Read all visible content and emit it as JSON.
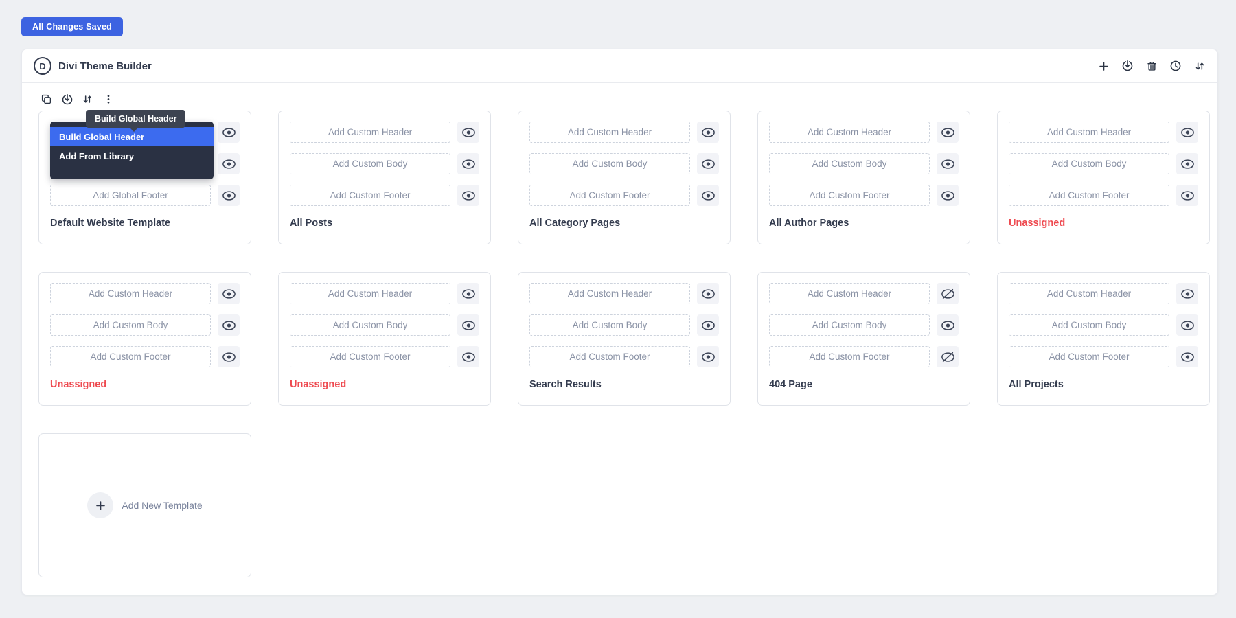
{
  "saved_badge": {
    "label": "All Changes Saved",
    "color": "#3d63e1"
  },
  "header": {
    "logo_letter": "D",
    "title": "Divi Theme Builder",
    "actions": [
      {
        "name": "new-template",
        "icon": "plus-icon"
      },
      {
        "name": "portability",
        "icon": "portability-icon"
      },
      {
        "name": "delete",
        "icon": "trash-icon"
      },
      {
        "name": "history",
        "icon": "history-icon"
      },
      {
        "name": "sort",
        "icon": "sort-icon"
      }
    ]
  },
  "card_toolbar": {
    "icons": [
      {
        "name": "duplicate",
        "icon": "duplicate-icon"
      },
      {
        "name": "portability",
        "icon": "portability-icon"
      },
      {
        "name": "sort",
        "icon": "sort-icon"
      },
      {
        "name": "more-options",
        "icon": "kebab-icon"
      }
    ]
  },
  "tooltip": {
    "label": "Build Global Header"
  },
  "dropdown": {
    "items": [
      {
        "label": "Build Global Header",
        "active": true
      },
      {
        "label": "Add From Library",
        "active": false
      }
    ]
  },
  "templates": [
    {
      "name": "Default Website Template",
      "unassigned": false,
      "overlay_open": true,
      "rows": [
        {
          "slot": "header",
          "covered": true,
          "eye": "visible"
        },
        {
          "slot": "body",
          "covered": true,
          "eye": "visible"
        },
        {
          "slot": "footer",
          "label": "Add Global Footer",
          "eye": "visible"
        }
      ]
    },
    {
      "name": "All Posts",
      "unassigned": false,
      "rows": [
        {
          "slot": "header",
          "label": "Add Custom Header",
          "eye": "visible"
        },
        {
          "slot": "body",
          "label": "Add Custom Body",
          "eye": "visible"
        },
        {
          "slot": "footer",
          "label": "Add Custom Footer",
          "eye": "visible"
        }
      ]
    },
    {
      "name": "All Category Pages",
      "unassigned": false,
      "rows": [
        {
          "slot": "header",
          "label": "Add Custom Header",
          "eye": "visible"
        },
        {
          "slot": "body",
          "label": "Add Custom Body",
          "eye": "visible"
        },
        {
          "slot": "footer",
          "label": "Add Custom Footer",
          "eye": "visible"
        }
      ]
    },
    {
      "name": "All Author Pages",
      "unassigned": false,
      "rows": [
        {
          "slot": "header",
          "label": "Add Custom Header",
          "eye": "visible"
        },
        {
          "slot": "body",
          "label": "Add Custom Body",
          "eye": "visible"
        },
        {
          "slot": "footer",
          "label": "Add Custom Footer",
          "eye": "visible"
        }
      ]
    },
    {
      "name": "Unassigned",
      "unassigned": true,
      "rows": [
        {
          "slot": "header",
          "label": "Add Custom Header",
          "eye": "visible"
        },
        {
          "slot": "body",
          "label": "Add Custom Body",
          "eye": "visible"
        },
        {
          "slot": "footer",
          "label": "Add Custom Footer",
          "eye": "visible"
        }
      ]
    },
    {
      "name": "Unassigned",
      "unassigned": true,
      "rows": [
        {
          "slot": "header",
          "label": "Add Custom Header",
          "eye": "visible"
        },
        {
          "slot": "body",
          "label": "Add Custom Body",
          "eye": "visible"
        },
        {
          "slot": "footer",
          "label": "Add Custom Footer",
          "eye": "visible"
        }
      ]
    },
    {
      "name": "Unassigned",
      "unassigned": true,
      "rows": [
        {
          "slot": "header",
          "label": "Add Custom Header",
          "eye": "visible"
        },
        {
          "slot": "body",
          "label": "Add Custom Body",
          "eye": "visible"
        },
        {
          "slot": "footer",
          "label": "Add Custom Footer",
          "eye": "visible"
        }
      ]
    },
    {
      "name": "Search Results",
      "unassigned": false,
      "rows": [
        {
          "slot": "header",
          "label": "Add Custom Header",
          "eye": "visible"
        },
        {
          "slot": "body",
          "label": "Add Custom Body",
          "eye": "visible"
        },
        {
          "slot": "footer",
          "label": "Add Custom Footer",
          "eye": "visible"
        }
      ]
    },
    {
      "name": "404 Page",
      "unassigned": false,
      "rows": [
        {
          "slot": "header",
          "label": "Add Custom Header",
          "eye": "hidden"
        },
        {
          "slot": "body",
          "label": "Add Custom Body",
          "eye": "visible"
        },
        {
          "slot": "footer",
          "label": "Add Custom Footer",
          "eye": "hidden"
        }
      ]
    },
    {
      "name": "All Projects",
      "unassigned": false,
      "rows": [
        {
          "slot": "header",
          "label": "Add Custom Header",
          "eye": "visible"
        },
        {
          "slot": "body",
          "label": "Add Custom Body",
          "eye": "visible"
        },
        {
          "slot": "footer",
          "label": "Add Custom Footer",
          "eye": "visible"
        }
      ]
    }
  ],
  "add_new": {
    "label": "Add New Template"
  },
  "colors": {
    "accent_blue": "#3d63e1",
    "menu_active_blue": "#3c6bef",
    "dropdown_bg": "#2a3143",
    "tooltip_bg": "#3d4351",
    "unassigned_red": "#ee4a50",
    "page_bg": "#eef0f3"
  }
}
